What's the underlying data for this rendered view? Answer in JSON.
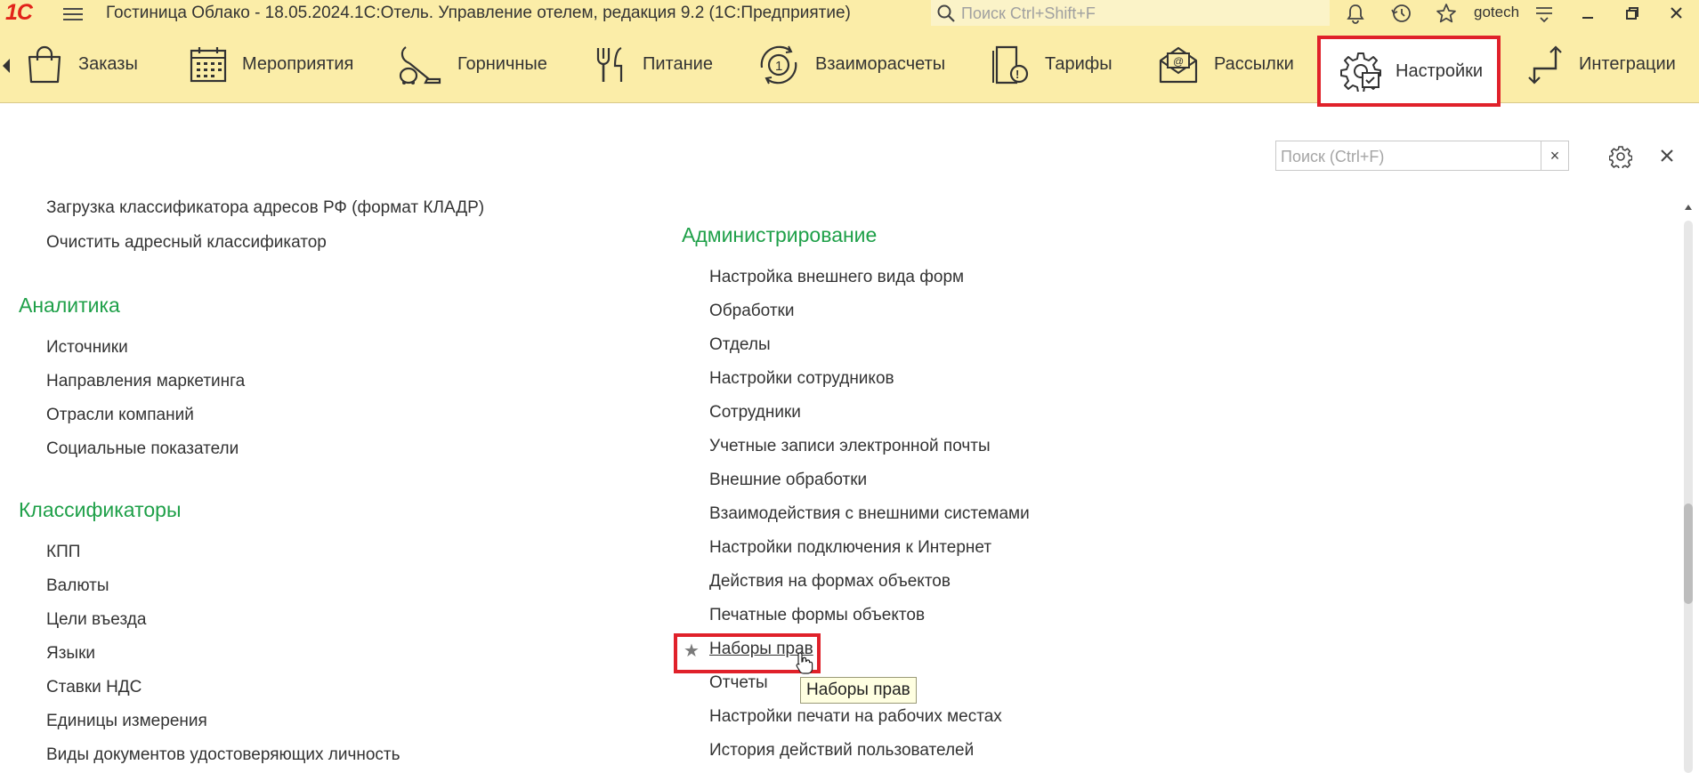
{
  "titlebar": {
    "logo": "1С",
    "title": "Гостиница Облако - 18.05.2024.1С:Отель. Управление отелем, редакция 9.2  (1С:Предприятие)",
    "search_placeholder": "Поиск Ctrl+Shift+F",
    "user": "gotech"
  },
  "sections": [
    {
      "label": "Заказы",
      "icon": "shopping-bag-icon"
    },
    {
      "label": "Мероприятия",
      "icon": "calendar-icon"
    },
    {
      "label": "Горничные",
      "icon": "vacuum-cleaner-icon"
    },
    {
      "label": "Питание",
      "icon": "fork-knife-icon"
    },
    {
      "label": "Взаиморасчеты",
      "icon": "coin-exchange-icon"
    },
    {
      "label": "Тарифы",
      "icon": "price-document-icon"
    },
    {
      "label": "Рассылки",
      "icon": "mail-icon"
    },
    {
      "label": "Настройки",
      "icon": "settings-gear-icon",
      "active": true
    },
    {
      "label": "Интеграции",
      "icon": "integration-arrows-icon"
    }
  ],
  "content": {
    "search_placeholder": "Поиск (Ctrl+F)",
    "left_top": [
      "Загрузка классификатора адресов РФ (формат КЛАДР)",
      "Очистить адресный классификатор"
    ],
    "analytics": {
      "title": "Аналитика",
      "items": [
        "Источники",
        "Направления маркетинга",
        "Отрасли компаний",
        "Социальные показатели"
      ]
    },
    "classifiers": {
      "title": "Классификаторы",
      "items": [
        "КПП",
        "Валюты",
        "Цели въезда",
        "Языки",
        "Ставки НДС",
        "Единицы измерения",
        "Виды документов удостоверяющих личность"
      ]
    },
    "administration": {
      "title": "Администрирование",
      "items": [
        "Настройка внешнего вида форм",
        "Обработки",
        "Отделы",
        "Настройки сотрудников",
        "Сотрудники",
        "Учетные записи электронной почты",
        "Внешние обработки",
        "Взаимодействия с внешними системами",
        "Настройки подключения к Интернет",
        "Действия на формах объектов",
        "Печатные формы объектов",
        "Наборы прав",
        "Отчеты",
        "Настройки печати на рабочих местах",
        "История действий пользователей"
      ]
    },
    "tooltip": "Наборы прав"
  },
  "colors": {
    "panel": "#fbeda8",
    "group_title": "#1fa049",
    "highlight": "#e0212a"
  }
}
